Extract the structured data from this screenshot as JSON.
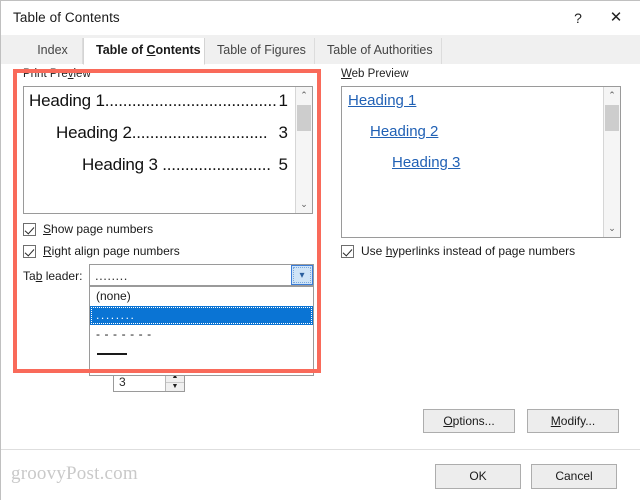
{
  "window": {
    "title": "Table of Contents",
    "help_icon": "question-mark-icon",
    "close_icon": "close-x-icon",
    "help_label": "?",
    "close_label": "✕"
  },
  "tabs": [
    {
      "label": "Index",
      "active": false
    },
    {
      "label": "Table of Contents",
      "active": true,
      "accel": "C"
    },
    {
      "label": "Table of Figures",
      "active": false
    },
    {
      "label": "Table of Authorities",
      "active": false
    }
  ],
  "print_preview": {
    "label": "Print Preview",
    "accel": "v",
    "lines": [
      {
        "text": "Heading 1",
        "leader": "......................................",
        "page": "1",
        "indent": 0
      },
      {
        "text": "Heading 2",
        "leader": "..............................",
        "page": "3",
        "indent": 1
      },
      {
        "text": "Heading 3",
        "leader": "........................",
        "page": "5",
        "indent": 2
      }
    ],
    "scrollbar": {
      "up": "⌃",
      "down": "⌄"
    }
  },
  "web_preview": {
    "label": "Web Preview",
    "accel": "W",
    "links": [
      "Heading 1",
      "Heading 2",
      "Heading 3"
    ],
    "link_color": "#2161b5",
    "scrollbar": {
      "up": "⌃",
      "down": "⌄"
    }
  },
  "options": {
    "show_page_numbers": {
      "label": "Show page numbers",
      "checked": true,
      "accel": "S"
    },
    "right_align": {
      "label": "Right align page numbers",
      "checked": true,
      "accel": "R"
    },
    "use_hyperlinks": {
      "label": "Use hyperlinks instead of page numbers",
      "checked": true,
      "accel": "h"
    }
  },
  "tab_leader": {
    "label": "Tab leader:",
    "accel": "b",
    "value": "........",
    "arrow_icon": "chevron-down-icon",
    "open": true,
    "options": [
      {
        "label": "(none)",
        "kind": "text",
        "selected": false
      },
      {
        "label": "........",
        "kind": "dots",
        "selected": true
      },
      {
        "label": "- - - - - - -",
        "kind": "dashes",
        "selected": false
      },
      {
        "label": "",
        "kind": "line",
        "selected": false
      }
    ]
  },
  "level_spinner": {
    "value": "3",
    "up_icon": "spinner-up-arrow-icon",
    "down_icon": "spinner-down-arrow-icon",
    "up_glyph": "▲",
    "down_glyph": "▼"
  },
  "buttons": {
    "options": {
      "label": "Options...",
      "accel": "O"
    },
    "modify": {
      "label": "Modify...",
      "accel": "M"
    },
    "ok": {
      "label": "OK"
    },
    "cancel": {
      "label": "Cancel"
    }
  },
  "watermark": {
    "text": "groovyPost.com"
  },
  "annotation": {
    "color": "#f96a5a",
    "shape": "rectangle-highlight"
  }
}
